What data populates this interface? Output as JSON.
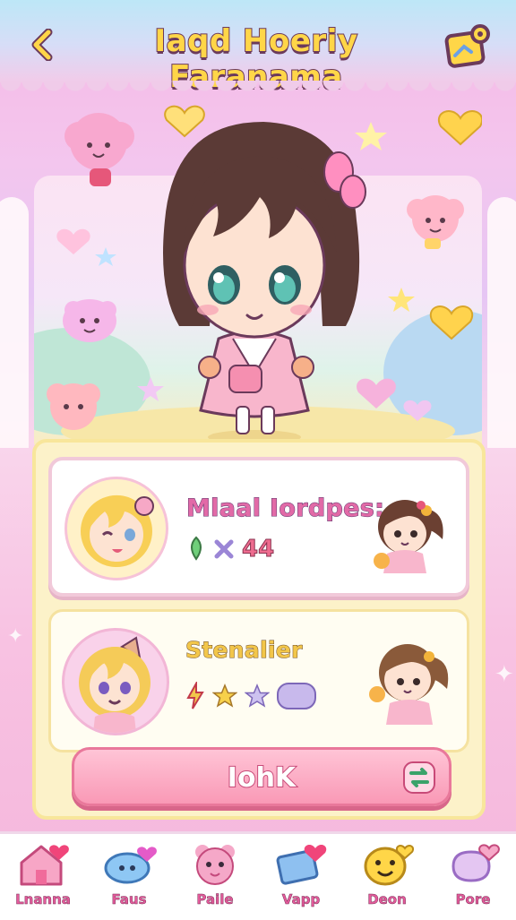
{
  "header": {
    "title": "Iaqd Hoeriy Faranama",
    "back_icon": "chevron-left-icon",
    "map_icon": "map-pin-icon"
  },
  "scene": {
    "character": "chibi-girl-character",
    "decorations": [
      "heart-icon",
      "star-icon",
      "cloud-creature-icon",
      "flower-icon"
    ]
  },
  "cards": [
    {
      "title": "Mlaal Iordpes:",
      "stats": {
        "icons": [
          "leaf-icon",
          "star-icon"
        ],
        "value": "44"
      },
      "avatar": "blonde-chibi-avatar",
      "side_character": "brown-hair-chibi"
    },
    {
      "title": "Stenalier",
      "stats": {
        "icons": [
          "lightning-icon",
          "star-icon",
          "star-icon",
          "pill-icon"
        ],
        "pill": ""
      },
      "avatar": "blonde-cat-ear-avatar",
      "side_character": "brown-hair-chibi-waving"
    }
  ],
  "cta": {
    "label": "IohK",
    "icon": "swap-arrow-icon"
  },
  "nav": [
    {
      "label": "Lnanna",
      "icon": "house-heart-icon"
    },
    {
      "label": "Faus",
      "icon": "cloud-heart-icon"
    },
    {
      "label": "Paile",
      "icon": "bear-face-icon"
    },
    {
      "label": "Vapp",
      "icon": "envelope-heart-icon"
    },
    {
      "label": "Deon",
      "icon": "smiley-face-icon"
    },
    {
      "label": "Pore",
      "icon": "gift-heart-icon"
    }
  ],
  "colors": {
    "accent_pink": "#f999b6",
    "title_yellow": "#ffd648",
    "panel_cream": "#fcf2c9",
    "outline_plum": "#6b3a5b"
  }
}
